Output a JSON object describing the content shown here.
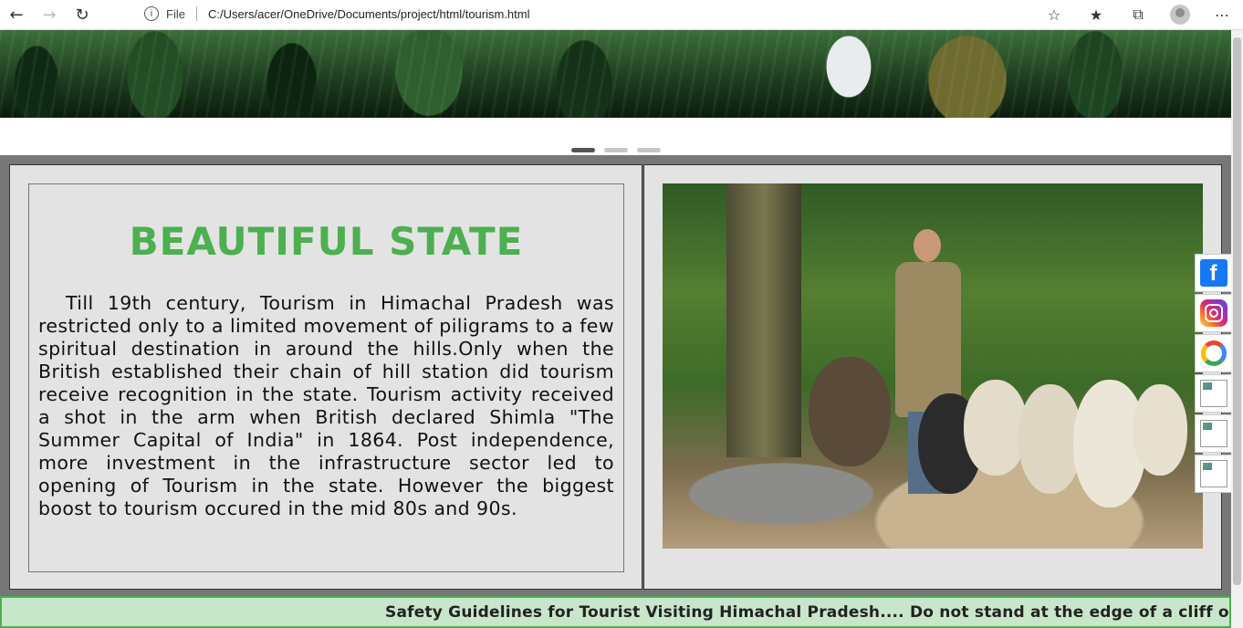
{
  "browser": {
    "file_label": "File",
    "url": "C:/Users/acer/OneDrive/Documents/project/html/tourism.html"
  },
  "carousel": {
    "slide_count": 3,
    "active_index": 0
  },
  "content": {
    "heading": "BEAUTIFUL STATE",
    "paragraph": "Till 19th century, Tourism in Himachal Pradesh was restricted only to a limited movement of piligrams to a few spiritual destination in around the hills.Only when the British established their chain of hill station did tourism receive recognition in the state. Tourism activity received a shot in the arm when British declared Shimla \"The Summer Capital of India\" in 1864. Post independence, more investment in the infrastructure sector led to opening of Tourism in the state. However the biggest boost to tourism occured in the mid 80s and 90s."
  },
  "social": [
    "facebook-icon",
    "instagram-icon",
    "google-icon",
    "broken-image-icon",
    "broken-image-icon",
    "broken-image-icon"
  ],
  "marquee": {
    "text": "Safety Guidelines for Tourist Visiting Himachal Pradesh.... Do not stand at the edge of a cliff or on any"
  },
  "colors": {
    "heading": "#4caf50",
    "marquee_bg": "#c8e6c9",
    "section_bg": "#777777"
  }
}
